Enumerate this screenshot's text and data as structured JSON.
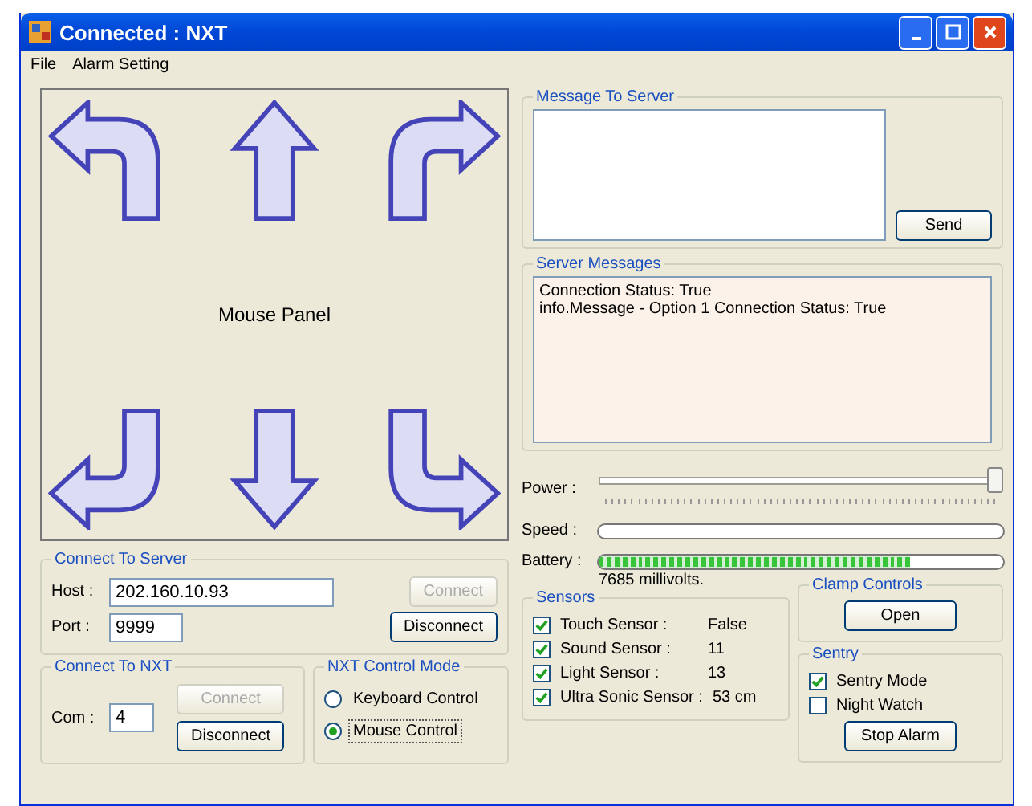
{
  "window": {
    "title": "Connected : NXT"
  },
  "menu": [
    "File",
    "Alarm Setting"
  ],
  "mouse_panel": {
    "label": "Mouse Panel"
  },
  "connect_to_server": {
    "title": "Connect To Server",
    "host_label": "Host :",
    "host": "202.160.10.93",
    "port_label": "Port :",
    "port": "9999",
    "connect": {
      "label": "Connect",
      "disabled": true
    },
    "disconnect": {
      "label": "Disconnect",
      "disabled": false
    }
  },
  "connect_to_nxt": {
    "title": "Connect To NXT",
    "com_label": "Com :",
    "com": "4",
    "connect": {
      "label": "Connect",
      "disabled": true
    },
    "disconnect": {
      "label": "Disconnect",
      "disabled": false
    }
  },
  "control_mode": {
    "title": "NXT Control Mode",
    "options": [
      {
        "label": "Keyboard Control",
        "selected": false
      },
      {
        "label": "Mouse Control",
        "selected": true
      }
    ]
  },
  "message_to_server": {
    "title": "Message To Server",
    "send": "Send"
  },
  "server_messages": {
    "title": "Server Messages",
    "lines": [
      "Connection Status: True",
      "info.Message - Option 1 Connection Status: True"
    ]
  },
  "power": {
    "label": "Power :",
    "level": 1.0
  },
  "speed": {
    "label": "Speed :"
  },
  "battery": {
    "label": "Battery :",
    "level": 0.77,
    "reading": "7685  millivolts."
  },
  "clamp_controls": {
    "title": "Clamp Controls",
    "button": "Open"
  },
  "sensors": {
    "title": "Sensors",
    "items": [
      {
        "label": "Touch Sensor :",
        "checked": true,
        "value": "False"
      },
      {
        "label": "Sound Sensor :",
        "checked": true,
        "value": "11"
      },
      {
        "label": "Light Sensor :",
        "checked": true,
        "value": "13"
      },
      {
        "label": "Ultra Sonic Sensor :",
        "checked": true,
        "value": "53 cm"
      }
    ]
  },
  "sentry": {
    "title": "Sentry",
    "options": [
      {
        "label": "Sentry Mode",
        "checked": true
      },
      {
        "label": "Night Watch",
        "checked": false
      }
    ],
    "button": "Stop Alarm"
  }
}
